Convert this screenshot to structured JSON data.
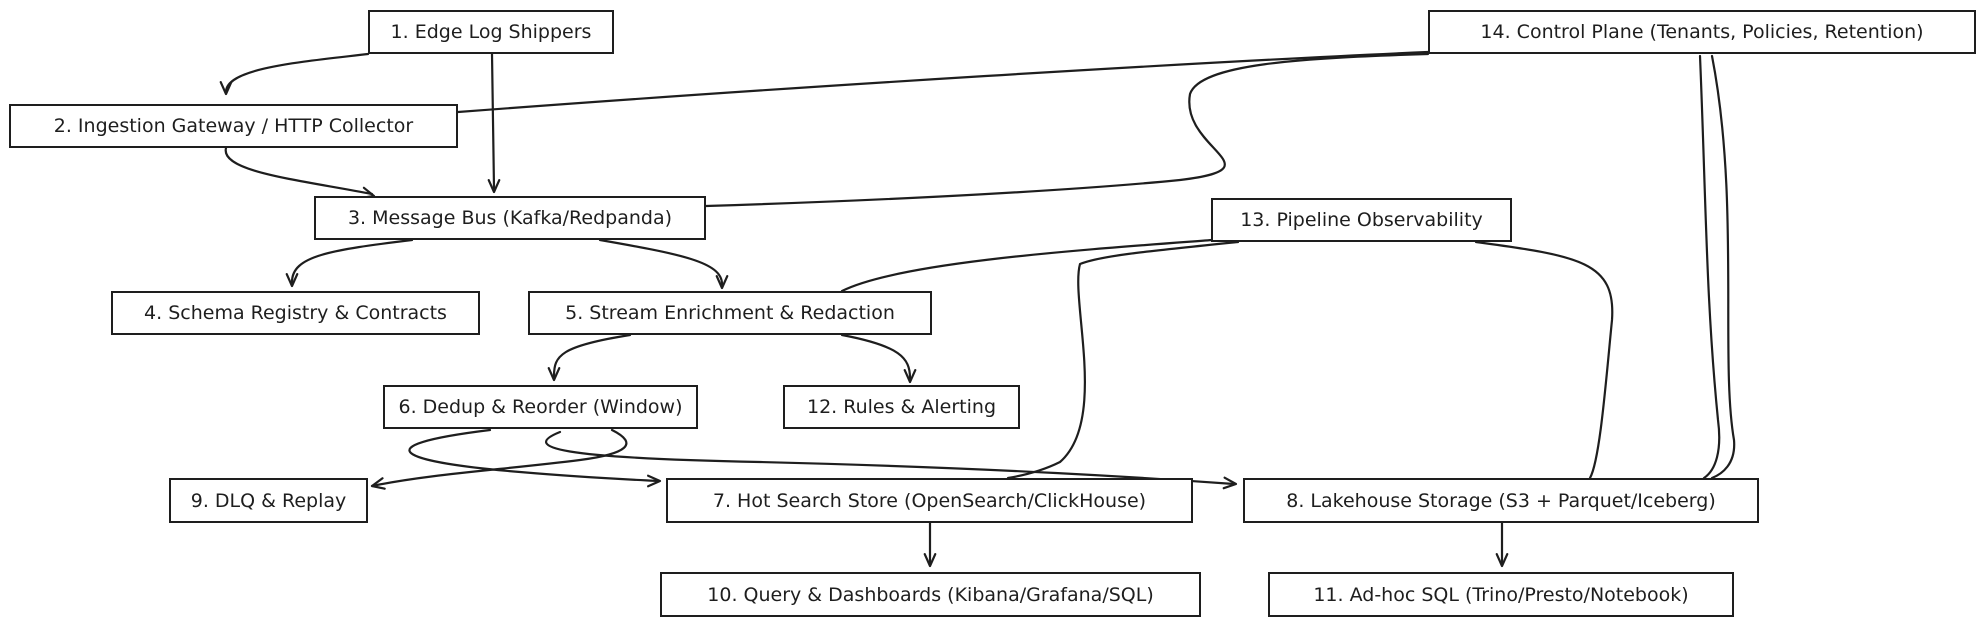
{
  "diagram": {
    "nodes": {
      "n1": {
        "label": "1. Edge Log Shippers"
      },
      "n2": {
        "label": "2. Ingestion Gateway / HTTP Collector"
      },
      "n3": {
        "label": "3. Message Bus (Kafka/Redpanda)"
      },
      "n4": {
        "label": "4. Schema Registry & Contracts"
      },
      "n5": {
        "label": "5. Stream Enrichment & Redaction"
      },
      "n6": {
        "label": "6. Dedup & Reorder (Window)"
      },
      "n7": {
        "label": "7. Hot Search Store (OpenSearch/ClickHouse)"
      },
      "n8": {
        "label": "8. Lakehouse Storage (S3 + Parquet/Iceberg)"
      },
      "n9": {
        "label": "9. DLQ & Replay"
      },
      "n10": {
        "label": "10. Query & Dashboards (Kibana/Grafana/SQL)"
      },
      "n11": {
        "label": "11. Ad-hoc SQL (Trino/Presto/Notebook)"
      },
      "n12": {
        "label": "12. Rules & Alerting"
      },
      "n13": {
        "label": "13. Pipeline Observability"
      },
      "n14": {
        "label": "14. Control Plane (Tenants, Policies, Retention)"
      }
    },
    "edges": [
      {
        "from": "n1",
        "to": "n2"
      },
      {
        "from": "n1",
        "to": "n3"
      },
      {
        "from": "n2",
        "to": "n3"
      },
      {
        "from": "n3",
        "to": "n4"
      },
      {
        "from": "n3",
        "to": "n5"
      },
      {
        "from": "n5",
        "to": "n6"
      },
      {
        "from": "n5",
        "to": "n12"
      },
      {
        "from": "n6",
        "to": "n9"
      },
      {
        "from": "n6",
        "to": "n7"
      },
      {
        "from": "n6",
        "to": "n8"
      },
      {
        "from": "n7",
        "to": "n10"
      },
      {
        "from": "n8",
        "to": "n11"
      },
      {
        "from": "n13",
        "to": "n5"
      },
      {
        "from": "n13",
        "to": "n7"
      },
      {
        "from": "n13",
        "to": "n8"
      },
      {
        "from": "n14",
        "to": "n2"
      },
      {
        "from": "n14",
        "to": "n3"
      },
      {
        "from": "n14",
        "to": "n8"
      }
    ]
  }
}
